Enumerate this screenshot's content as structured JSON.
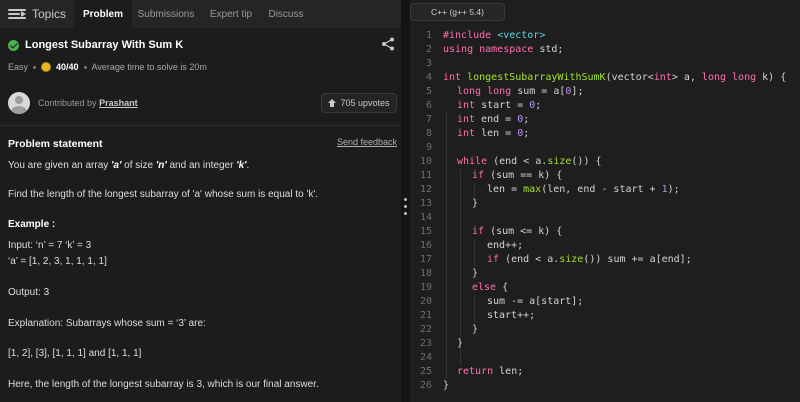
{
  "tabs": {
    "topics": "Topics",
    "problem": "Problem",
    "submissions": "Submissions",
    "expert_tip": "Expert tip",
    "discuss": "Discuss"
  },
  "problem": {
    "title": "Longest Subarray With Sum K",
    "difficulty": "Easy",
    "score": "40/40",
    "avg_time": "Average time to solve is 20m",
    "contributed_by": "Contributed by",
    "author": "Prashant",
    "upvotes": "705 upvotes",
    "statement_heading": "Problem statement",
    "send_feedback": "Send feedback"
  },
  "statement": {
    "l1_a": "You are given an array ",
    "l1_b": "'a'",
    "l1_c": " of size ",
    "l1_d": "'n'",
    "l1_e": " and an integer ",
    "l1_f": "'k'",
    "l1_g": ".",
    "l2": "Find the length of the longest subarray of 'a' whose sum is equal to 'k'.",
    "example_heading": "Example :",
    "input1": "Input: ‘n’ = 7 ‘k’ = 3",
    "input2": "‘a’ = [1, 2, 3, 1, 1, 1, 1]",
    "output": "Output: 3",
    "explanation": "Explanation: Subarrays whose sum = ‘3’ are:",
    "subarrays": "[1, 2], [3], [1, 1, 1] and [1, 1, 1]",
    "final": "Here, the length of the longest subarray is 3, which is our final answer."
  },
  "editor": {
    "language": "C++ (g++ 5.4)",
    "line_numbers": [
      "1",
      "2",
      "3",
      "4",
      "5",
      "6",
      "7",
      "8",
      "9",
      "10",
      "11",
      "12",
      "13",
      "14",
      "15",
      "16",
      "17",
      "18",
      "19",
      "20",
      "21",
      "22",
      "23",
      "24",
      "25",
      "26"
    ],
    "code": {
      "l1a": "#include ",
      "l1b": "<vector>",
      "l2a": "using namespace ",
      "l2b": "std;",
      "l4a": "int ",
      "l4b": "longestSubarrayWithSumK",
      "l4c": "(vector<",
      "l4d": "int",
      "l4e": "> a, ",
      "l4f": "long long ",
      "l4g": "k) {",
      "l5a": "long long ",
      "l5b": "sum = a[",
      "l5c": "0",
      "l5d": "];",
      "l6a": "int ",
      "l6b": "start = ",
      "l6c": "0",
      "l6d": ";",
      "l7a": "int ",
      "l7b": "end = ",
      "l7c": "0",
      "l7d": ";",
      "l8a": "int ",
      "l8b": "len = ",
      "l8c": "0",
      "l8d": ";",
      "l10a": "while ",
      "l10b": "(end < a.",
      "l10c": "size",
      "l10d": "()) {",
      "l11a": "if ",
      "l11b": "(sum == k) {",
      "l12a": "len = ",
      "l12b": "max",
      "l12c": "(len, end - start + ",
      "l12d": "1",
      "l12e": ");",
      "l13": "}",
      "l15a": "if ",
      "l15b": "(sum <= k) {",
      "l16": "end++;",
      "l17a": "if ",
      "l17b": "(end < a.",
      "l17c": "size",
      "l17d": "()) sum += a[end];",
      "l18": "}",
      "l19a": "else ",
      "l19b": "{",
      "l20": "sum -= a[start];",
      "l21": "start++;",
      "l22": "}",
      "l23": "}",
      "l25a": "return ",
      "l25b": "len;",
      "l26": "}"
    }
  }
}
